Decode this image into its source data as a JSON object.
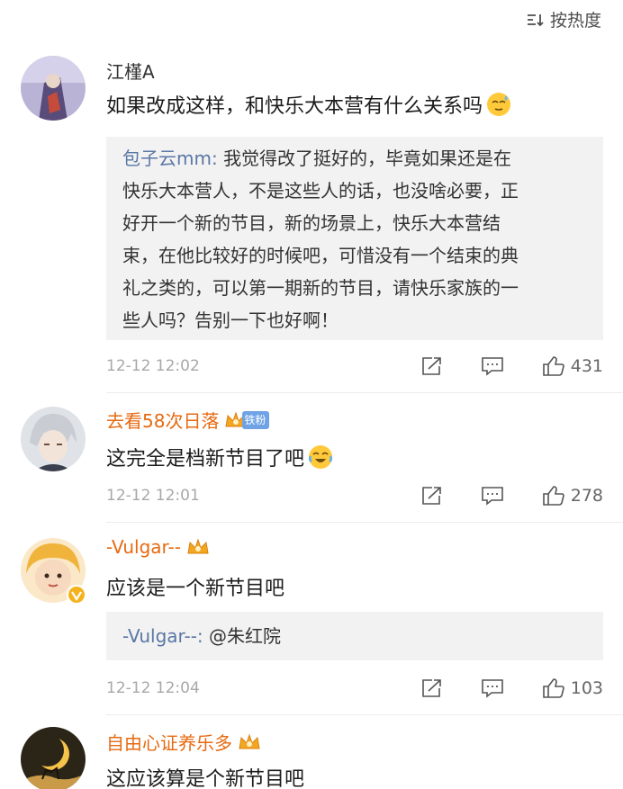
{
  "sort": {
    "label": "按热度"
  },
  "comments": [
    {
      "username": "江槿A",
      "text": "如果改成这样，和快乐大本营有什么关系吗",
      "quote": {
        "name": "包子云mm:",
        "lines": [
          "我觉得改了挺好的，毕竟如果还是在",
          "快乐大本营人，不是这些人的话，也没啥必要，正",
          "好开一个新的节目，新的场景上，快乐大本营结",
          "束，在他比较好的时候吧，可惜没有一个结束的典",
          "礼之类的，可以第一期新的节目，请快乐家族的一",
          "些人吗？告别一下也好啊！"
        ]
      },
      "time": "12-12 12:02",
      "likes": "431"
    },
    {
      "username": "去看58次日落",
      "badge_text": "铁粉",
      "text": "这完全是档新节目了吧",
      "time": "12-12 12:01",
      "likes": "278"
    },
    {
      "username": "-Vulgar--",
      "text": "应该是一个新节目吧",
      "quote": {
        "name": "-Vulgar--:",
        "body": " @朱红院"
      },
      "time": "12-12 12:04",
      "likes": "103"
    },
    {
      "username": "自由心证养乐多",
      "text": "这应该算是个新节目吧"
    }
  ],
  "icons": {
    "sort": "sort-icon",
    "share": "share-icon",
    "reply": "reply-icon",
    "like": "thumbs-up-icon",
    "vip": "crown-icon"
  },
  "colors": {
    "orange_name": "#e66a12",
    "quote_name": "#5a77a6",
    "quote_bg": "#f2f2f2",
    "meta": "#a8a8a8"
  }
}
